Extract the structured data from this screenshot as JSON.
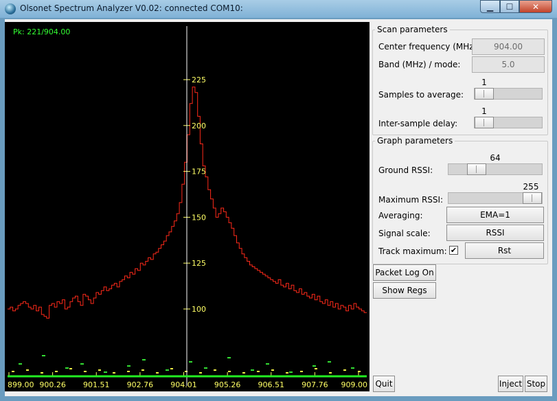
{
  "window": {
    "title": "Olsonet Spectrum Analyzer V0.02: connected COM10:"
  },
  "graph": {
    "peak_readout": "Pk: 221/904.00",
    "y_ticks": [
      "225",
      "200",
      "175",
      "150",
      "125",
      "100"
    ],
    "x_ticks": [
      "899.00",
      "900.26",
      "901.51",
      "902.76",
      "904.01",
      "905.26",
      "906.51",
      "907.76",
      "909.00"
    ],
    "rssi_trace": [
      100,
      101,
      99,
      100,
      102,
      103,
      104,
      103,
      101,
      100,
      102,
      99,
      101,
      97,
      96,
      95,
      102,
      103,
      101,
      104,
      103,
      105,
      100,
      101,
      104,
      106,
      107,
      104,
      102,
      108,
      107,
      105,
      103,
      106,
      109,
      108,
      110,
      112,
      110,
      111,
      113,
      114,
      112,
      115,
      116,
      118,
      117,
      120,
      119,
      122,
      121,
      125,
      124,
      126,
      128,
      127,
      130,
      131,
      133,
      135,
      137,
      140,
      142,
      145,
      148,
      152,
      158,
      168,
      180,
      195,
      212,
      221,
      218,
      205,
      190,
      178,
      172,
      165,
      160,
      155,
      150,
      152,
      155,
      153,
      150,
      147,
      144,
      140,
      136,
      133,
      130,
      128,
      126,
      124,
      123,
      122,
      121,
      120,
      119,
      118,
      117,
      116,
      115,
      114,
      116,
      113,
      112,
      114,
      111,
      113,
      110,
      109,
      111,
      108,
      109,
      107,
      106,
      108,
      105,
      107,
      104,
      103,
      105,
      102,
      104,
      101,
      103,
      100,
      102,
      101,
      99,
      102,
      100,
      103,
      101,
      100,
      99,
      98
    ],
    "noise_top": [
      5,
      9,
      3,
      5,
      1,
      4,
      7,
      2,
      6,
      3,
      8,
      2,
      5,
      1,
      4,
      6,
      3
    ],
    "noise_low": [
      2,
      3,
      1,
      2,
      4,
      2,
      3,
      1,
      2,
      3,
      1,
      4,
      2,
      1,
      3,
      2,
      1,
      2,
      3,
      1,
      2,
      4,
      1,
      3,
      2
    ]
  },
  "scan": {
    "group_title": "Scan parameters",
    "center_label": "Center frequency (MHz):",
    "center_value": "904.00",
    "band_label": "Band (MHz) / mode:",
    "band_value": "5.0",
    "samples_label": "Samples to average:",
    "samples_value": "1",
    "samples_level": 0.0,
    "delay_label": "Inter-sample delay:",
    "delay_value": "1",
    "delay_level": 0.0
  },
  "graph_params": {
    "group_title": "Graph parameters",
    "ground_label": "Ground RSSI:",
    "ground_value": "64",
    "ground_level": 0.25,
    "max_label": "Maximum RSSI:",
    "max_value": "255",
    "max_level": 1.0,
    "averaging_label": "Averaging:",
    "averaging_value": "EMA=1",
    "scale_label": "Signal scale:",
    "scale_value": "RSSI",
    "track_label": "Track maximum:",
    "track_checked": "✔",
    "reset_label": "Rst"
  },
  "buttons": {
    "packet_log": "Packet Log On",
    "show_regs": "Show Regs",
    "quit": "Quit",
    "inject": "Inject",
    "stop": "Stop"
  },
  "colors": {
    "trace": "#ff2a1a",
    "axis_text": "#ffff66",
    "baseline": "#22ee22",
    "peak_text": "#33ff33"
  }
}
